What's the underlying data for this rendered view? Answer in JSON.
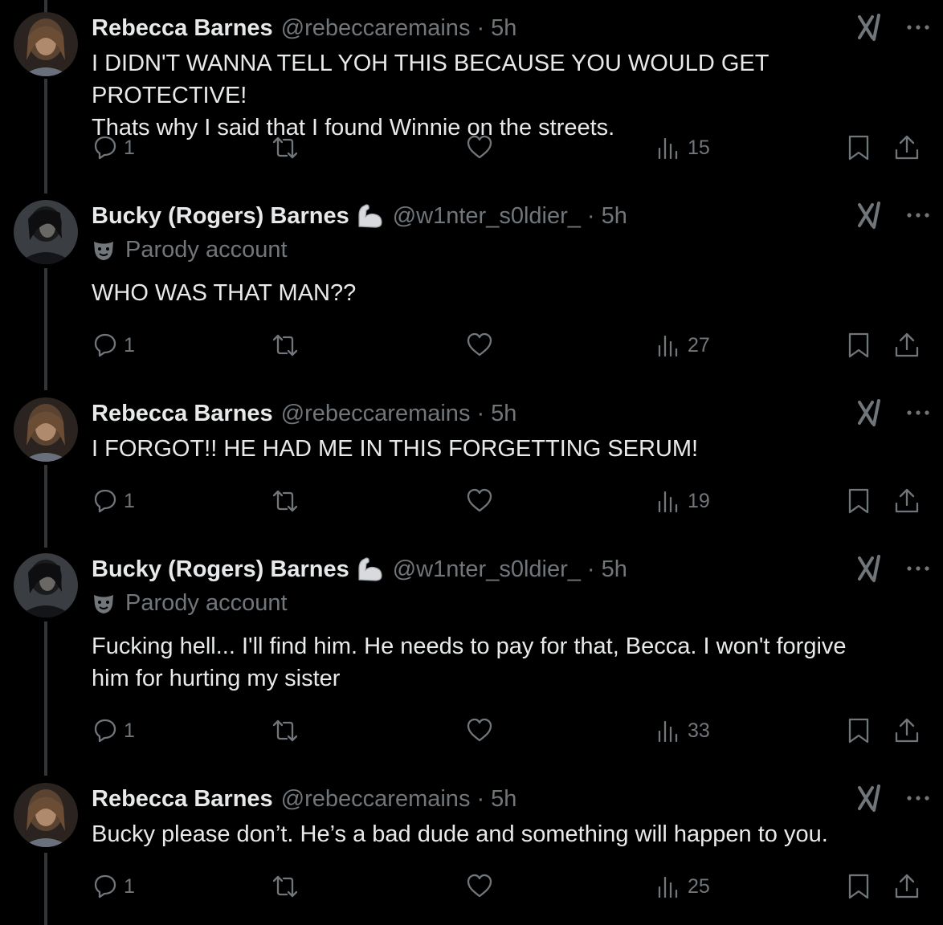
{
  "tweets": [
    {
      "name": "Rebecca Barnes",
      "handle": "@rebeccaremains",
      "time": "5h",
      "parody": false,
      "text": [
        "I DIDN'T WANNA TELL YOH THIS BECAUSE YOU WOULD GET PROTECTIVE!",
        "Thats why I said that I found Winnie on the streets."
      ],
      "replies": "1",
      "views": "15"
    },
    {
      "name": "Bucky (Rogers) Barnes",
      "handle": "@w1nter_s0ldier_",
      "time": "5h",
      "parody": true,
      "parody_label": "Parody account",
      "badge_icon": "flexed-biceps-emoji",
      "text": [
        "WHO WAS THAT MAN??"
      ],
      "replies": "1",
      "views": "27"
    },
    {
      "name": "Rebecca Barnes",
      "handle": "@rebeccaremains",
      "time": "5h",
      "parody": false,
      "text": [
        "I FORGOT!! HE HAD ME IN THIS FORGETTING SERUM!"
      ],
      "replies": "1",
      "views": "19"
    },
    {
      "name": "Bucky (Rogers) Barnes",
      "handle": "@w1nter_s0ldier_",
      "time": "5h",
      "parody": true,
      "parody_label": "Parody account",
      "badge_icon": "flexed-biceps-emoji",
      "text": [
        "Fucking hell... I'll find him. He needs to pay for that, Becca. I won't forgive",
        "him for hurting my sister"
      ],
      "replies": "1",
      "views": "33"
    },
    {
      "name": "Rebecca Barnes",
      "handle": "@rebeccaremains",
      "time": "5h",
      "parody": false,
      "text": [
        "Bucky please don’t. He’s a bad dude and something will happen to you."
      ],
      "replies": "1",
      "views": "25"
    }
  ],
  "separator": "·",
  "icons": [
    "reply-icon",
    "retweet-icon",
    "like-icon",
    "views-icon",
    "bookmark-icon",
    "share-icon",
    "grok-icon",
    "more-icon",
    "mask-icon"
  ],
  "colors": {
    "background": "#000000",
    "text": "#e7e9ea",
    "muted": "#71767b",
    "thread_line": "#333639"
  }
}
